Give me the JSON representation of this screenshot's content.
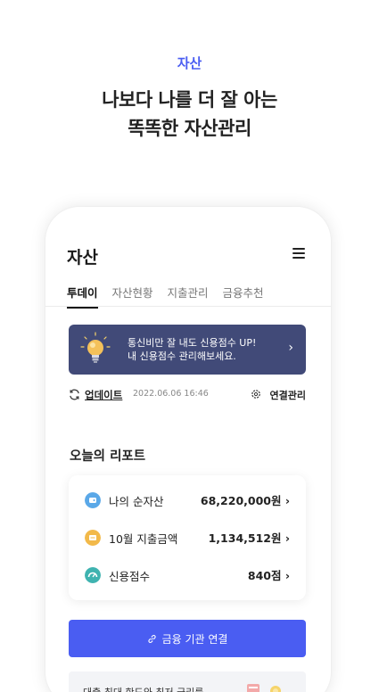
{
  "hero": {
    "category": "자산",
    "headline_line1": "나보다 나를 더 잘 아는",
    "headline_line2": "똑똑한 자산관리"
  },
  "app": {
    "title": "자산",
    "menu_icon": "hamburger-menu-icon"
  },
  "tabs": [
    {
      "label": "투데이",
      "active": true
    },
    {
      "label": "자산현황",
      "active": false
    },
    {
      "label": "지출관리",
      "active": false
    },
    {
      "label": "금융추천",
      "active": false
    }
  ],
  "banner": {
    "line1": "통신비만 잘 내도 신용점수 UP!",
    "line2": "내 신용점수 관리해보세요.",
    "chevron": "›",
    "icon": "lightbulb-icon",
    "background": "#414a78"
  },
  "update": {
    "link_label": "업데이트",
    "timestamp": "2022.06.06 16:46",
    "manage_label": "연결관리"
  },
  "report": {
    "title": "오늘의 리포트",
    "rows": [
      {
        "label": "나의 순자산",
        "value": "68,220,000원 ›",
        "icon": "wallet-icon",
        "icon_color": "#5aa8e8"
      },
      {
        "label": "10월 지출금액",
        "value": "1,134,512원 ›",
        "icon": "card-icon",
        "icon_color": "#f2b94a"
      },
      {
        "label": "신용점수",
        "value": "840점 ›",
        "icon": "gauge-icon",
        "icon_color": "#3fb3b0"
      }
    ]
  },
  "connect_button": {
    "label": "금융 기관 연결",
    "icon": "link-icon",
    "color": "#4a5df2"
  },
  "promo": {
    "text": "대출 최대 한도와 최저 금리를"
  }
}
